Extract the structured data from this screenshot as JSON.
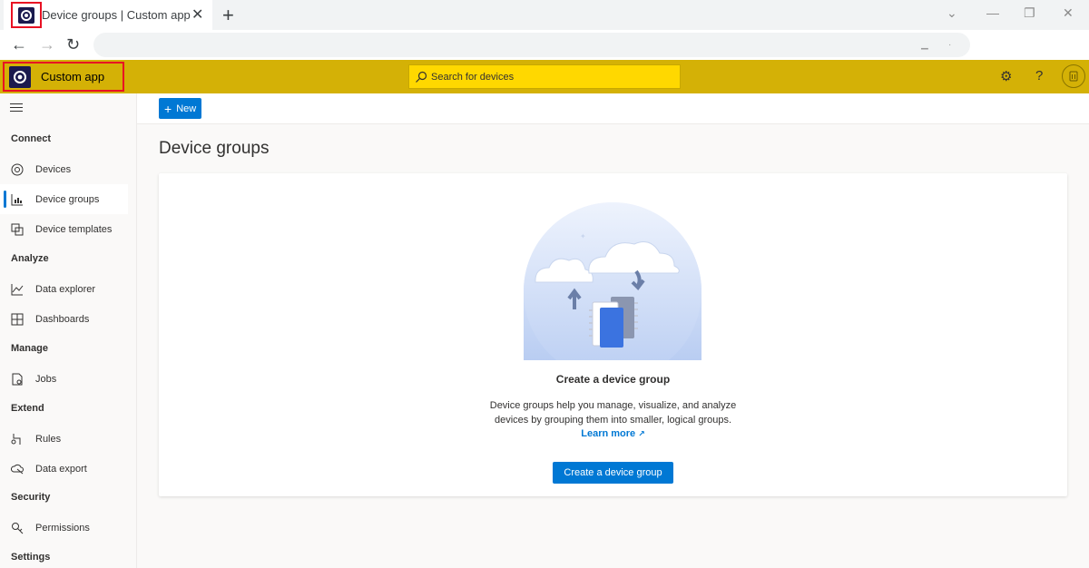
{
  "browser": {
    "tab_title": "Device groups | Custom app",
    "new_tab": "+",
    "close_tab": "✕"
  },
  "header": {
    "app_name": "Custom app",
    "search_placeholder": "Search for devices",
    "colors": {
      "header_bg": "#d4b106",
      "search_bg": "#ffd800",
      "accent": "#0078d4"
    }
  },
  "sidebar": {
    "sections": [
      {
        "title": "Connect",
        "items": [
          {
            "label": "Devices",
            "icon": "devices-icon"
          },
          {
            "label": "Device groups",
            "icon": "device-groups-icon",
            "active": true
          },
          {
            "label": "Device templates",
            "icon": "device-templates-icon"
          }
        ]
      },
      {
        "title": "Analyze",
        "items": [
          {
            "label": "Data explorer",
            "icon": "data-explorer-icon"
          },
          {
            "label": "Dashboards",
            "icon": "dashboards-icon"
          }
        ]
      },
      {
        "title": "Manage",
        "items": [
          {
            "label": "Jobs",
            "icon": "jobs-icon"
          }
        ]
      },
      {
        "title": "Extend",
        "items": [
          {
            "label": "Rules",
            "icon": "rules-icon"
          },
          {
            "label": "Data export",
            "icon": "data-export-icon"
          }
        ]
      },
      {
        "title": "Security",
        "items": [
          {
            "label": "Permissions",
            "icon": "permissions-icon"
          }
        ]
      },
      {
        "title": "Settings",
        "items": []
      }
    ]
  },
  "commandbar": {
    "new_label": "New"
  },
  "main": {
    "title": "Device groups",
    "empty_title": "Create a device group",
    "empty_desc_line1": "Device groups help you manage, visualize, and analyze",
    "empty_desc_line2": "devices by grouping them into smaller, logical groups.",
    "learn_more": "Learn more",
    "cta_label": "Create a device group"
  }
}
